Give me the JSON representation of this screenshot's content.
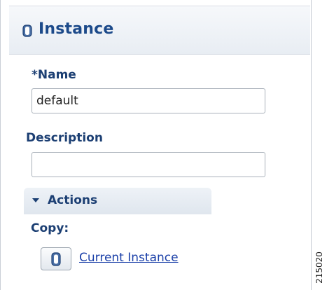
{
  "panel": {
    "title": "Instance",
    "title_icon": "database-icon"
  },
  "form": {
    "name_label": "*Name",
    "name_value": "default",
    "description_label": "Description",
    "description_value": ""
  },
  "actions": {
    "section_label": "Actions",
    "copy_label": "Copy:",
    "copy_link_label": "Current Instance",
    "copy_icon": "database-icon"
  },
  "figure_id": "215020",
  "colors": {
    "title": "#1c4a8a",
    "label": "#1c3f73",
    "link": "#1a3fa8"
  }
}
